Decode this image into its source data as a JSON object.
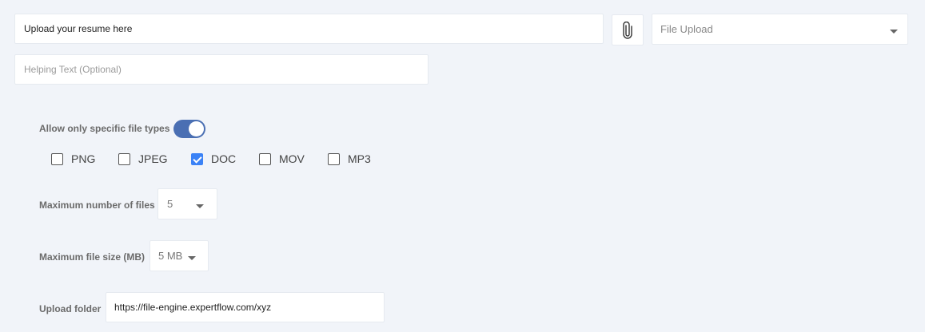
{
  "question_input": {
    "value": "Upload your resume here"
  },
  "attach_button": {
    "icon": "paperclip-icon"
  },
  "type_select": {
    "selected": "File Upload"
  },
  "helping_text": {
    "placeholder": "Helping Text (Optional)"
  },
  "file_types": {
    "toggle_label": "Allow only specific file types",
    "toggle_on": true,
    "options": [
      {
        "label": "PNG",
        "checked": false
      },
      {
        "label": "JPEG",
        "checked": false
      },
      {
        "label": "DOC",
        "checked": true
      },
      {
        "label": "MOV",
        "checked": false
      },
      {
        "label": "MP3",
        "checked": false
      }
    ]
  },
  "max_files": {
    "label": "Maximum number of files",
    "selected": "5"
  },
  "max_size": {
    "label": "Maximum file size (MB)",
    "selected": "5 MB"
  },
  "upload_folder": {
    "label": "Upload folder",
    "value": "https://file-engine.expertflow.com/xyz"
  },
  "colors": {
    "accent": "#4a6fb3",
    "checkbox": "#3b82f6",
    "background": "#f1f4f9"
  }
}
